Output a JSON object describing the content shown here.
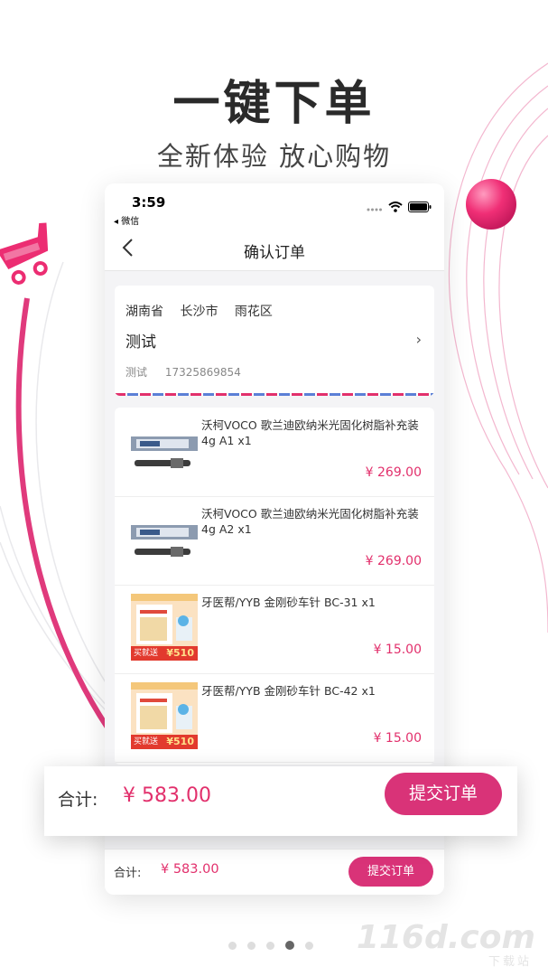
{
  "header": {
    "headline": "一键下单",
    "subhead": "全新体验  放心购物"
  },
  "status_bar": {
    "time": "3:59",
    "back_app": "◂ 微信"
  },
  "nav": {
    "title": "确认订单"
  },
  "address": {
    "region": [
      "湖南省",
      "长沙市",
      "雨花区"
    ],
    "name": "测试",
    "contact_name": "测试",
    "phone": "17325869854"
  },
  "goods": [
    {
      "name": "沃柯VOCO 歌兰迪欧纳米光固化树脂补充装4g A1  x1",
      "price": "¥ 269.00",
      "thumb": "syringe-product-image"
    },
    {
      "name": "沃柯VOCO 歌兰迪欧纳米光固化树脂补充装4g A2  x1",
      "price": "¥ 269.00",
      "thumb": "syringe-product-image"
    },
    {
      "name": "牙医帮/YYB 金刚砂车针 BC-31  x1",
      "price": "¥ 15.00",
      "thumb": "bur-promo-image",
      "promo_badge": "买就送",
      "promo_value": "¥510"
    },
    {
      "name": "牙医帮/YYB 金刚砂车针 BC-42  x1",
      "price": "¥ 15.00",
      "thumb": "bur-promo-image",
      "promo_badge": "买就送",
      "promo_value": "¥510"
    }
  ],
  "summary": {
    "total_label": "合计:",
    "total_value": "¥  583.00",
    "submit_label": "提交订单"
  },
  "summary_inner": {
    "total_label": "合计:",
    "total_value": "¥  583.00",
    "submit_label": "提交订单"
  },
  "pager": {
    "count": 5,
    "active_index": 3
  },
  "watermark": {
    "main": "116d.com",
    "sub": "下载站"
  },
  "colors": {
    "accent": "#d93378",
    "price": "#e2306c",
    "background": "#ffffff",
    "phone_bg": "#f4f4f6"
  }
}
